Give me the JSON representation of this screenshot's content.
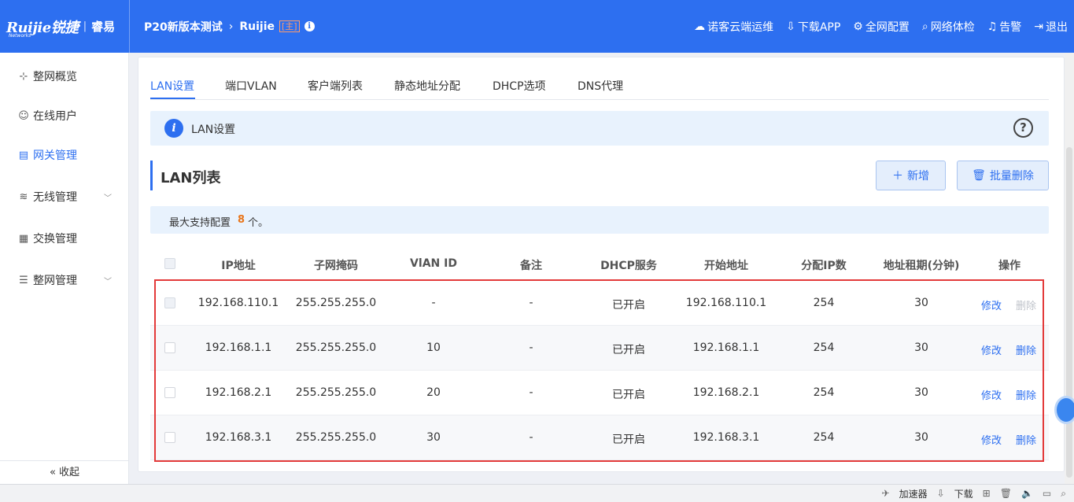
{
  "header": {
    "logo_main": "Ruijie锐捷",
    "logo_sub": "Networks",
    "logo_second": "睿易",
    "crumb_network": "P20新版本测试",
    "crumb_device": "Ruijie",
    "crumb_tag": "[主]",
    "actions": [
      {
        "icon": "cloud-icon",
        "label": "诺客云端运维"
      },
      {
        "icon": "download-icon",
        "label": "下载APP"
      },
      {
        "icon": "network-config-icon",
        "label": "全网配置"
      },
      {
        "icon": "network-check-icon",
        "label": "网络体检"
      },
      {
        "icon": "alarm-icon",
        "label": "告警"
      },
      {
        "icon": "logout-icon",
        "label": "退出"
      }
    ]
  },
  "sidebar": {
    "items": [
      {
        "icon": "topology-icon",
        "label": "整网概览"
      },
      {
        "icon": "user-icon",
        "label": "在线用户"
      },
      {
        "icon": "gateway-icon",
        "label": "网关管理"
      },
      {
        "icon": "wifi-icon",
        "label": "无线管理"
      },
      {
        "icon": "switch-icon",
        "label": "交换管理"
      },
      {
        "icon": "settings-list-icon",
        "label": "整网管理"
      }
    ],
    "collapse_label": "收起"
  },
  "tabs": [
    "LAN设置",
    "端口VLAN",
    "客户端列表",
    "静态地址分配",
    "DHCP选项",
    "DNS代理"
  ],
  "info": {
    "title": "LAN设置",
    "help": "?"
  },
  "section": {
    "title": "LAN列表",
    "add_label": "新增",
    "batch_delete_label": "批量删除"
  },
  "note": {
    "prefix": "最大支持配置",
    "count": "8",
    "suffix": "个。"
  },
  "table": {
    "headers": [
      "IP地址",
      "子网掩码",
      "VlAN ID",
      "备注",
      "DHCP服务",
      "开始地址",
      "分配IP数",
      "地址租期(分钟)",
      "操作"
    ],
    "rows": [
      {
        "ip": "192.168.110.1",
        "mask": "255.255.255.0",
        "vlan": "-",
        "remark": "-",
        "dhcp": "已开启",
        "start": "192.168.110.1",
        "count": "254",
        "lease": "30",
        "edit": "修改",
        "delete": "删除",
        "delete_disabled": true
      },
      {
        "ip": "192.168.1.1",
        "mask": "255.255.255.0",
        "vlan": "10",
        "remark": "-",
        "dhcp": "已开启",
        "start": "192.168.1.1",
        "count": "254",
        "lease": "30",
        "edit": "修改",
        "delete": "删除",
        "delete_disabled": false
      },
      {
        "ip": "192.168.2.1",
        "mask": "255.255.255.0",
        "vlan": "20",
        "remark": "-",
        "dhcp": "已开启",
        "start": "192.168.2.1",
        "count": "254",
        "lease": "30",
        "edit": "修改",
        "delete": "删除",
        "delete_disabled": false
      },
      {
        "ip": "192.168.3.1",
        "mask": "255.255.255.0",
        "vlan": "30",
        "remark": "-",
        "dhcp": "已开启",
        "start": "192.168.3.1",
        "count": "254",
        "lease": "30",
        "edit": "修改",
        "delete": "删除",
        "delete_disabled": false
      }
    ]
  },
  "statusbar": {
    "accelerator": "加速器",
    "download": "下载"
  },
  "colors": {
    "accent": "#2d6ff0",
    "highlight": "#e33a3a",
    "count": "#e8751a"
  }
}
